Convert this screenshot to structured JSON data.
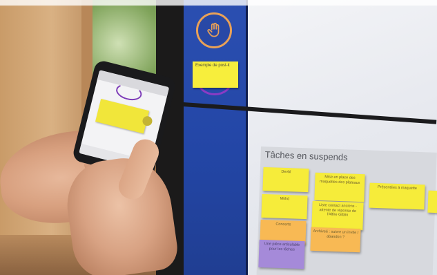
{
  "toolbar": {
    "sample_postit_label": "Exemple de post-it"
  },
  "board": {
    "section_title": "Tâches en suspends",
    "notes": [
      {
        "text": "Devbl",
        "color": "yellow"
      },
      {
        "text": "Mise en place des maquettes des plateaux",
        "color": "yellow"
      },
      {
        "text": "Présentées à maquette",
        "color": "yellow"
      },
      {
        "text": "Mkhd",
        "color": "yellow"
      },
      {
        "text": "Liste contact anciens - attente de réponse de l'Alfire Gibtin",
        "color": "yellow"
      },
      {
        "text": "Concerts",
        "color": "orange"
      },
      {
        "text": "Archiveé : suivre un invite / abandon ?",
        "color": "orange"
      },
      {
        "text": "Une pièce articulable pour les tâches",
        "color": "purple"
      }
    ]
  },
  "colors": {
    "toolbar_blue": "#2346a6",
    "postit_yellow": "#f6ec3a",
    "postit_orange": "#f8b954",
    "postit_purple": "#a58ad9",
    "hand_tool_ring": "#e9a157"
  }
}
